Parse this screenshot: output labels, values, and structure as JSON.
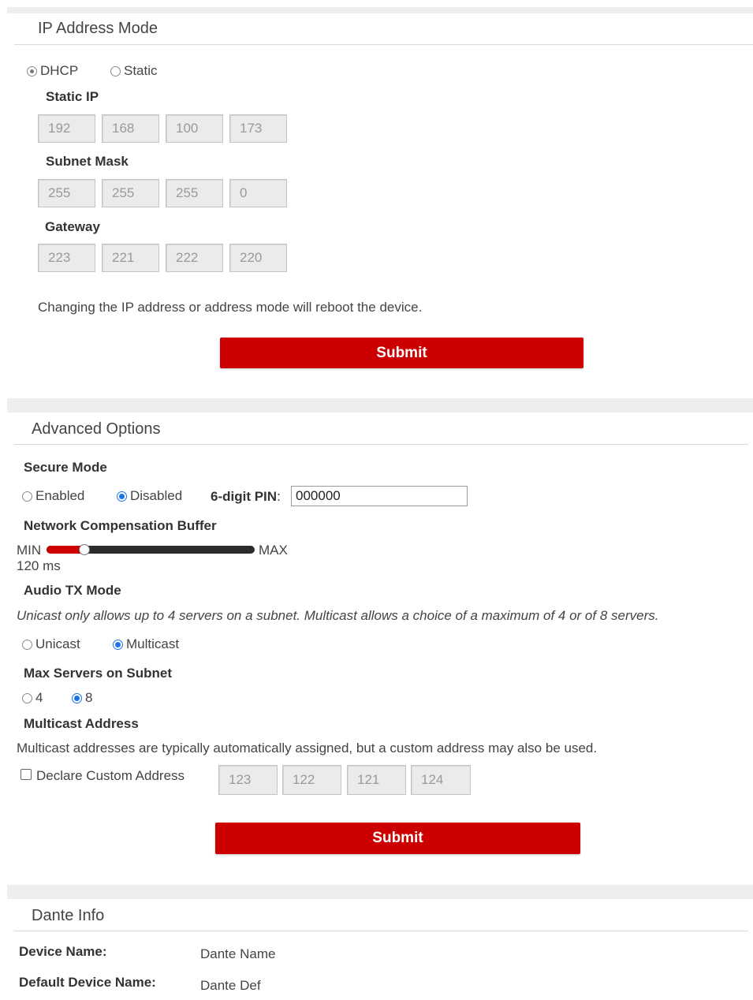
{
  "ip_section": {
    "title": "IP Address Mode",
    "mode_dhcp": "DHCP",
    "mode_static": "Static",
    "static_ip_label": "Static IP",
    "static_ip": [
      "192",
      "168",
      "100",
      "173"
    ],
    "subnet_label": "Subnet Mask",
    "subnet": [
      "255",
      "255",
      "255",
      "0"
    ],
    "gateway_label": "Gateway",
    "gateway": [
      "223",
      "221",
      "222",
      "220"
    ],
    "note": "Changing the IP address or address mode will reboot the device.",
    "submit": "Submit"
  },
  "advanced": {
    "title": "Advanced Options",
    "secure_label": "Secure Mode",
    "secure_enabled": "Enabled",
    "secure_disabled": "Disabled",
    "pin_label": "6-digit PIN",
    "pin_colon": ":",
    "pin_value": "000000",
    "buffer_label": "Network Compensation Buffer",
    "buffer_min": "MIN",
    "buffer_max": "MAX",
    "buffer_value": "120 ms",
    "buffer_fraction": 0.18,
    "tx_label": "Audio TX Mode",
    "tx_note": "Unicast only allows up to 4 servers on a subnet. Multicast allows a choice of a maximum of 4 or of 8 servers.",
    "tx_unicast": "Unicast",
    "tx_multicast": "Multicast",
    "max_label": "Max Servers on Subnet",
    "max_4": "4",
    "max_8": "8",
    "mc_label": "Multicast Address",
    "mc_note": "Multicast addresses are typically automatically assigned, but a custom address may also be used.",
    "custom_label": "Declare Custom Address",
    "mc_address": [
      "123",
      "122",
      "121",
      "124"
    ],
    "submit": "Submit"
  },
  "dante": {
    "title": "Dante Info",
    "device_name_label": "Device Name:",
    "device_name": "Dante Name",
    "default_name_label": "Default Device Name:",
    "default_name": "Dante Def"
  },
  "colors": {
    "accent": "#cc0000",
    "radio_selected": "#1a73e8",
    "band": "#eeeeee"
  }
}
